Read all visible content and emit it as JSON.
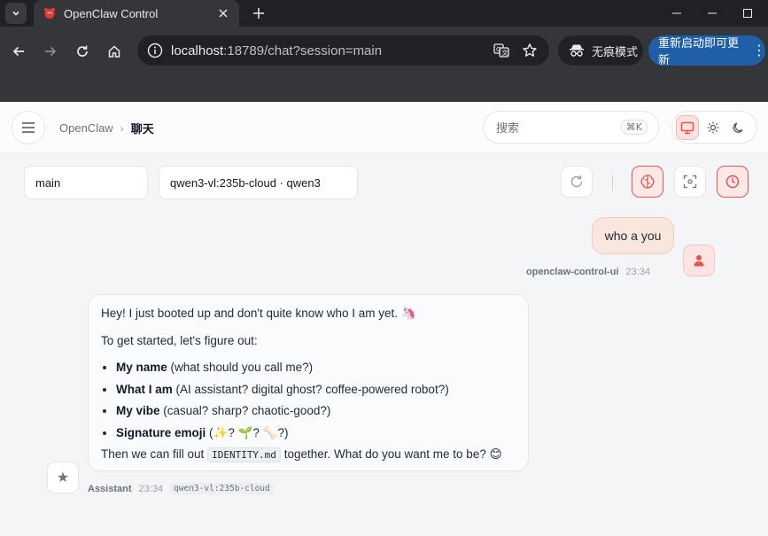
{
  "browser": {
    "tab_title": "OpenClaw Control",
    "url_host": "localhost",
    "url_rest": ":18789/chat?session=main",
    "incognito_label": "无痕模式",
    "restart_label": "重新启动即可更新",
    "icons": [
      "chevron-down-icon",
      "openclaw-favicon-icon",
      "close-icon",
      "plus-icon",
      "minimize-icon",
      "maximize-icon",
      "back-icon",
      "forward-icon",
      "reload-icon",
      "home-icon",
      "site-info-icon",
      "translate-icon",
      "star-icon",
      "incognito-icon",
      "more-vert-icon"
    ]
  },
  "header": {
    "breadcrumb_root": "OpenClaw",
    "breadcrumb_sep": "›",
    "breadcrumb_current": "聊天",
    "search_placeholder": "搜索",
    "search_shortcut": "⌘K",
    "theme_options": [
      "system",
      "light",
      "dark"
    ],
    "theme_active": "system"
  },
  "session": {
    "session_value": "main",
    "model_value": "qwen3-vl:235b-cloud · qwen3",
    "controls": [
      "refresh-icon",
      "brain-icon",
      "focus-icon",
      "clock-icon"
    ]
  },
  "messages": {
    "user": {
      "text": "who a you",
      "sender": "openclaw-control-ui",
      "time": "23:34"
    },
    "assistant": {
      "greeting": "Hey! I just booted up and don't quite know who I am yet. 🦄",
      "intro": "To get started, let's figure out:",
      "items": [
        {
          "label": "My name",
          "detail": " (what should you call me?)"
        },
        {
          "label": "What I am",
          "detail": " (AI assistant? digital ghost? coffee-powered robot?)"
        },
        {
          "label": "My vibe",
          "detail": " (casual? sharp? chaotic-good?)"
        },
        {
          "label": "Signature emoji",
          "detail": " (✨? 🌱? 🦴?)"
        }
      ],
      "outro_before": "Then we can fill out ",
      "outro_code": "IDENTITY.md",
      "outro_after": " together. What do you want me to be? 😊",
      "sender": "Assistant",
      "time": "23:34",
      "model": "qwen3-vl:235b-cloud"
    }
  },
  "colors": {
    "accent_red": "#e2554f",
    "user_bubble": "#f9e6dc",
    "restart_blue": "#1f5fa8"
  }
}
